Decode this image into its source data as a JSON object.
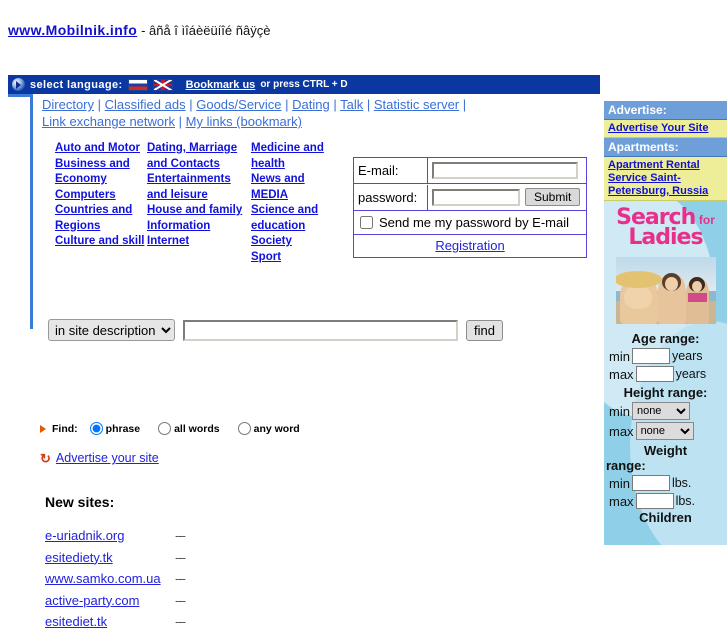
{
  "top": {
    "site_link": "www.Mobilnik.info",
    "tagline": "- âñå î ìîáèëüíîé ñâÿçè"
  },
  "langbar": {
    "label": "select language:",
    "flags": [
      "flag-russia-icon",
      "flag-uk-icon"
    ],
    "bookmark_link": "Bookmark us",
    "bookmark_tail": " or press CTRL + D",
    "icon": "play-circle-icon"
  },
  "nav": {
    "row1": [
      "Directory",
      "Classified ads",
      "Goods/Service",
      "Dating",
      "Talk",
      "Statistic server"
    ],
    "row2": [
      "Link exchange network",
      "My links (bookmark)"
    ],
    "separator": "|"
  },
  "categories": {
    "col1": [
      "Auto and Motor",
      "Business and Economy",
      "Computers",
      "Countries and Regions",
      "Culture and skill"
    ],
    "col2": [
      "Dating, Marriage and Contacts",
      "Entertainments and leisure",
      "House and family",
      "Information",
      "Internet"
    ],
    "col3": [
      "Medicine and health",
      "News and MEDIA",
      "Science and education",
      "Society",
      "Sport"
    ]
  },
  "login": {
    "email_label": "E-mail:",
    "email_value": "",
    "password_label": "password:",
    "password_value": "",
    "submit_label": "Submit",
    "checkbox_label": "Send me my password by E-mail",
    "checkbox_checked": false,
    "registration_link": "Registration"
  },
  "search": {
    "scope_selected": "in site description",
    "scope_options": [
      "in site description"
    ],
    "query_value": "",
    "find_label": "find",
    "find_prefix": "Find:",
    "modes": [
      {
        "label": "phrase",
        "checked": true
      },
      {
        "label": "all words",
        "checked": false
      },
      {
        "label": "any word",
        "checked": false
      }
    ]
  },
  "advertise_link": {
    "icon": "recycle-icon",
    "label": "Advertise your site"
  },
  "new_sites": {
    "title": "New sites:",
    "rows": [
      {
        "name": "e-uriadnik.org",
        "desc": "---"
      },
      {
        "name": "esitediety.tk",
        "desc": "---"
      },
      {
        "name": "www.samko.com.ua",
        "desc": "---"
      },
      {
        "name": "active-party.com",
        "desc": "---"
      },
      {
        "name": "esitediet.tk",
        "desc": "---"
      }
    ]
  },
  "sidebar": {
    "advertise_header": "Advertise:",
    "advertise_link": "Advertise Your Site",
    "apartments_header": "Apartments:",
    "apartments_link": "Apartment Rental Service Saint-Petersburg, Russia",
    "ladies": {
      "title_line1": "Search",
      "title_small": "for",
      "title_line2": "Ladies",
      "photo": "three-women-beach-photo",
      "age_label": "Age range:",
      "age_min_value": "",
      "age_max_value": "",
      "age_unit": "years",
      "height_label": "Height range:",
      "height_min_value": "none",
      "height_max_value": "none",
      "height_options": [
        "none"
      ],
      "weight_label_line1": "Weight",
      "weight_label_line2": "range:",
      "weight_min_value": "",
      "weight_max_value": "",
      "weight_unit": "lbs.",
      "min_label": "min",
      "max_label": "max",
      "cutoff_label": "Children"
    }
  },
  "colors": {
    "link": "#2222cc",
    "langbar_bg": "#0b37a0",
    "sidebar_header_bg": "#6f9fd8",
    "sidebar_link_bg": "#eeee99",
    "ladies_bg": "#8fd0e8",
    "ladies_pink": "#e8308a",
    "rule_blue": "#3a7bd5"
  }
}
